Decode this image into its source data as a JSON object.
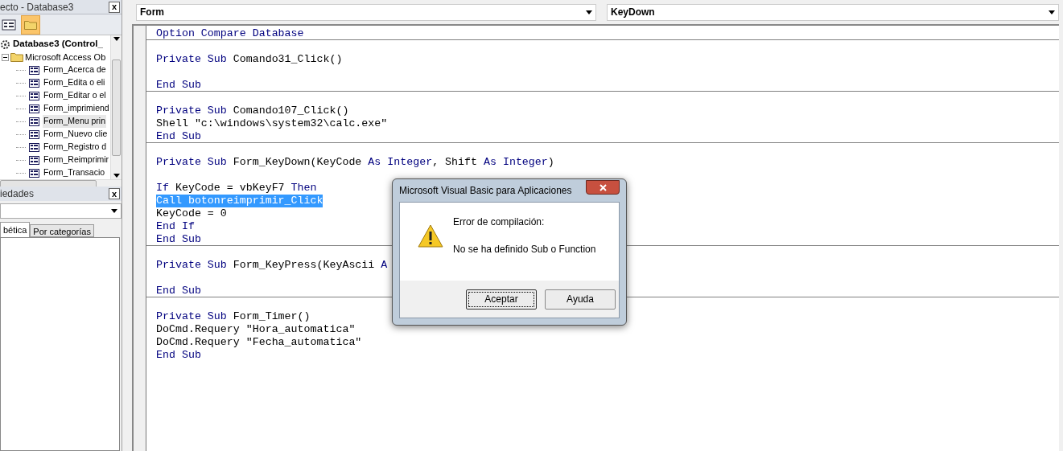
{
  "project_panel": {
    "title": "ecto - Database3",
    "close": "x",
    "tree": {
      "label": "Database3 (Control_",
      "children": [
        {
          "label": "Microsoft Access Ob",
          "expanded": true,
          "children": [
            {
              "label": "Form_Acerca de",
              "selected": false
            },
            {
              "label": "Form_Edita o eli",
              "selected": false
            },
            {
              "label": "Form_Editar o el",
              "selected": false
            },
            {
              "label": "Form_imprimiend",
              "selected": false
            },
            {
              "label": "Form_Menu prin",
              "selected": true
            },
            {
              "label": "Form_Nuevo clie",
              "selected": false
            },
            {
              "label": "Form_Registro d",
              "selected": false
            },
            {
              "label": "Form_Reimprimir",
              "selected": false
            },
            {
              "label": "Form_Transacio",
              "selected": false
            }
          ]
        }
      ]
    }
  },
  "properties_panel": {
    "title": "iedades",
    "close": "x",
    "tabs": [
      {
        "label": "bética",
        "selected": true
      },
      {
        "label": "Por categorías",
        "selected": false
      }
    ]
  },
  "object_combo": {
    "value": "Form"
  },
  "procedure_combo": {
    "value": "KeyDown"
  },
  "code": [
    {
      "kind": "code",
      "selected": false,
      "segments": [
        {
          "text": "Option Compare Database",
          "kind": "keyword"
        }
      ]
    },
    {
      "kind": "separator"
    },
    {
      "kind": "blank"
    },
    {
      "kind": "code",
      "selected": false,
      "segments": [
        {
          "text": "Private Sub",
          "kind": "keyword"
        },
        {
          "text": " Comando31_Click()",
          "kind": "plain"
        }
      ]
    },
    {
      "kind": "blank"
    },
    {
      "kind": "code",
      "selected": false,
      "segments": [
        {
          "text": "End Sub",
          "kind": "keyword"
        }
      ]
    },
    {
      "kind": "separator"
    },
    {
      "kind": "blank"
    },
    {
      "kind": "code",
      "selected": false,
      "segments": [
        {
          "text": "Private Sub",
          "kind": "keyword"
        },
        {
          "text": " Comando107_Click()",
          "kind": "plain"
        }
      ]
    },
    {
      "kind": "code",
      "selected": false,
      "segments": [
        {
          "text": "Shell \"c:\\windows\\system32\\calc.exe\"",
          "kind": "plain"
        }
      ]
    },
    {
      "kind": "code",
      "selected": false,
      "segments": [
        {
          "text": "End Sub",
          "kind": "keyword"
        }
      ]
    },
    {
      "kind": "separator"
    },
    {
      "kind": "blank"
    },
    {
      "kind": "code",
      "selected": false,
      "segments": [
        {
          "text": "Private Sub",
          "kind": "keyword"
        },
        {
          "text": " Form_KeyDown(KeyCode ",
          "kind": "plain"
        },
        {
          "text": "As Integer",
          "kind": "keyword"
        },
        {
          "text": ", Shift ",
          "kind": "plain"
        },
        {
          "text": "As Integer",
          "kind": "keyword"
        },
        {
          "text": ")",
          "kind": "plain"
        }
      ]
    },
    {
      "kind": "blank"
    },
    {
      "kind": "code",
      "selected": false,
      "segments": [
        {
          "text": "If",
          "kind": "keyword"
        },
        {
          "text": " KeyCode = vbKeyF7 ",
          "kind": "plain"
        },
        {
          "text": "Then",
          "kind": "keyword"
        }
      ]
    },
    {
      "kind": "code",
      "selected": true,
      "segments": [
        {
          "text": "Call botonreimprimir_Click",
          "kind": "plain"
        }
      ]
    },
    {
      "kind": "code",
      "selected": false,
      "segments": [
        {
          "text": "KeyCode = 0",
          "kind": "plain"
        }
      ]
    },
    {
      "kind": "code",
      "selected": false,
      "segments": [
        {
          "text": "End If",
          "kind": "keyword"
        }
      ]
    },
    {
      "kind": "code",
      "selected": false,
      "segments": [
        {
          "text": "End Sub",
          "kind": "keyword"
        }
      ]
    },
    {
      "kind": "separator"
    },
    {
      "kind": "blank"
    },
    {
      "kind": "code",
      "selected": false,
      "segments": [
        {
          "text": "Private Sub",
          "kind": "keyword"
        },
        {
          "text": " Form_KeyPress(KeyAscii ",
          "kind": "plain"
        },
        {
          "text": "A",
          "kind": "keyword"
        }
      ]
    },
    {
      "kind": "blank"
    },
    {
      "kind": "code",
      "selected": false,
      "segments": [
        {
          "text": "End Sub",
          "kind": "keyword"
        }
      ]
    },
    {
      "kind": "separator"
    },
    {
      "kind": "blank"
    },
    {
      "kind": "code",
      "selected": false,
      "segments": [
        {
          "text": "Private Sub",
          "kind": "keyword"
        },
        {
          "text": " Form_Timer()",
          "kind": "plain"
        }
      ]
    },
    {
      "kind": "code",
      "selected": false,
      "segments": [
        {
          "text": "DoCmd.Requery \"Hora_automatica\"",
          "kind": "plain"
        }
      ]
    },
    {
      "kind": "code",
      "selected": false,
      "segments": [
        {
          "text": "DoCmd.Requery \"Fecha_automatica\"",
          "kind": "plain"
        }
      ]
    },
    {
      "kind": "code",
      "selected": false,
      "segments": [
        {
          "text": "End Sub",
          "kind": "keyword"
        }
      ]
    }
  ],
  "dialog": {
    "title": "Microsoft Visual Basic para Aplicaciones",
    "heading": "Error de compilación:",
    "message": "No se ha definido Sub o Function",
    "buttons": [
      {
        "label": "Aceptar",
        "focused": true
      },
      {
        "label": "Ayuda",
        "focused": false
      }
    ]
  }
}
